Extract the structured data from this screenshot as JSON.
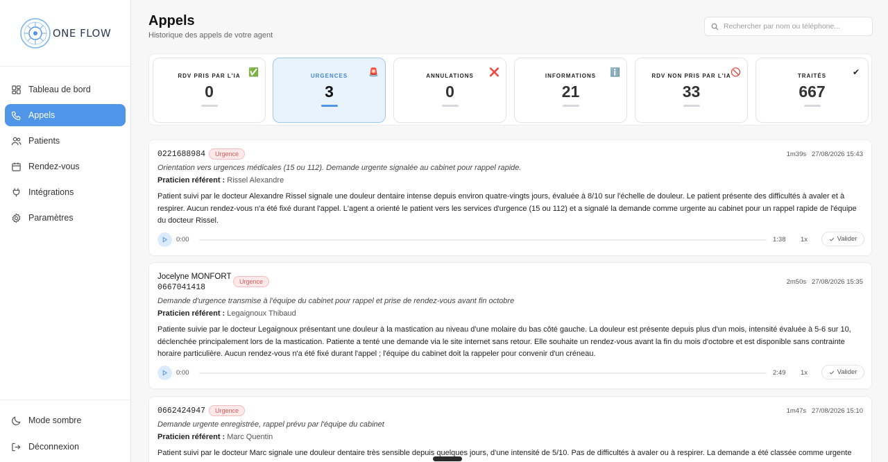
{
  "brand": {
    "name": "ONE FLOW",
    "accent": "#4f95e8",
    "urgent": "#d45a5a"
  },
  "sidebar": {
    "items": [
      {
        "label": "Tableau de bord",
        "icon": "dashboard-icon"
      },
      {
        "label": "Appels",
        "icon": "phone-icon",
        "active": true
      },
      {
        "label": "Patients",
        "icon": "users-icon"
      },
      {
        "label": "Rendez-vous",
        "icon": "calendar-icon"
      },
      {
        "label": "Intégrations",
        "icon": "plug-icon"
      },
      {
        "label": "Paramètres",
        "icon": "gear-icon"
      }
    ],
    "bottom": [
      {
        "label": "Mode sombre",
        "icon": "moon-icon"
      },
      {
        "label": "Déconnexion",
        "icon": "logout-icon"
      }
    ]
  },
  "header": {
    "title": "Appels",
    "subtitle": "Historique des appels de votre agent",
    "search_placeholder": "Rechercher par nom ou téléphone..."
  },
  "stats": [
    {
      "label": "RDV PRIS PAR L'IA",
      "value": "0",
      "icon": "✅"
    },
    {
      "label": "URGENCES",
      "value": "3",
      "icon": "🚨",
      "active": true
    },
    {
      "label": "ANNULATIONS",
      "value": "0",
      "icon": "❌"
    },
    {
      "label": "INFORMATIONS",
      "value": "21",
      "icon": "ℹ️"
    },
    {
      "label": "RDV NON PRIS PAR L'IA",
      "value": "33",
      "icon": "🚫"
    },
    {
      "label": "TRAITÉS",
      "value": "667",
      "icon": "✔"
    }
  ],
  "calls": [
    {
      "phone": "0221688984",
      "badge": "Urgence",
      "duration": "1m39s",
      "datetime": "27/08/2026 15:43",
      "summary": "Orientation vers urgences médicales (15 ou 112). Demande urgente signalée au cabinet pour rappel rapide.",
      "ref_label": "Praticien référent :",
      "ref_name": "Rissel Alexandre",
      "description": "Patient suivi par le docteur Alexandre Rissel signale une douleur dentaire intense depuis environ quatre-vingts jours, évaluée à 8/10 sur l'échelle de douleur. Le patient présente des difficultés à avaler et à respirer. Aucun rendez-vous n'a été fixé durant l'appel. L'agent a orienté le patient vers les services d'urgence (15 ou 112) et a signalé la demande comme urgente au cabinet pour un rappel rapide de l'équipe du docteur Rissel.",
      "player": {
        "current": "0:00",
        "length": "1:38",
        "speed": "1x",
        "validate": "Valider"
      }
    },
    {
      "name": "Jocelyne MONFORT",
      "phone": "0667041418",
      "badge": "Urgence",
      "duration": "2m50s",
      "datetime": "27/08/2026 15:35",
      "summary": "Demande d'urgence transmise à l'équipe du cabinet pour rappel et prise de rendez-vous avant fin octobre",
      "ref_label": "Praticien référent :",
      "ref_name": "Legaignoux Thibaud",
      "description": "Patiente suivie par le docteur Legaignoux présentant une douleur à la mastication au niveau d'une molaire du bas côté gauche. La douleur est présente depuis plus d'un mois, intensité évaluée à 5-6 sur 10, déclenchée principalement lors de la mastication. Patiente a tenté une demande via le site internet sans retour. Elle souhaite un rendez-vous avant la fin du mois d'octobre et est disponible sans contrainte horaire particulière. Aucun rendez-vous n'a été fixé durant l'appel ; l'équipe du cabinet doit la rappeler pour convenir d'un créneau.",
      "player": {
        "current": "0:00",
        "length": "2:49",
        "speed": "1x",
        "validate": "Valider"
      }
    },
    {
      "phone": "0662424947",
      "badge": "Urgence",
      "duration": "1m47s",
      "datetime": "27/08/2026 15:10",
      "summary": "Demande urgente enregistrée, rappel prévu par l'équipe du cabinet",
      "ref_label": "Praticien référent :",
      "ref_name": "Marc Quentin",
      "description": "Patient suivi par le docteur Marc signale une douleur dentaire très sensible depuis quelques jours, d'une intensité de 5/10. Pas de difficultés à avaler ou à respirer. La demande a été classée comme urgente et"
    }
  ]
}
